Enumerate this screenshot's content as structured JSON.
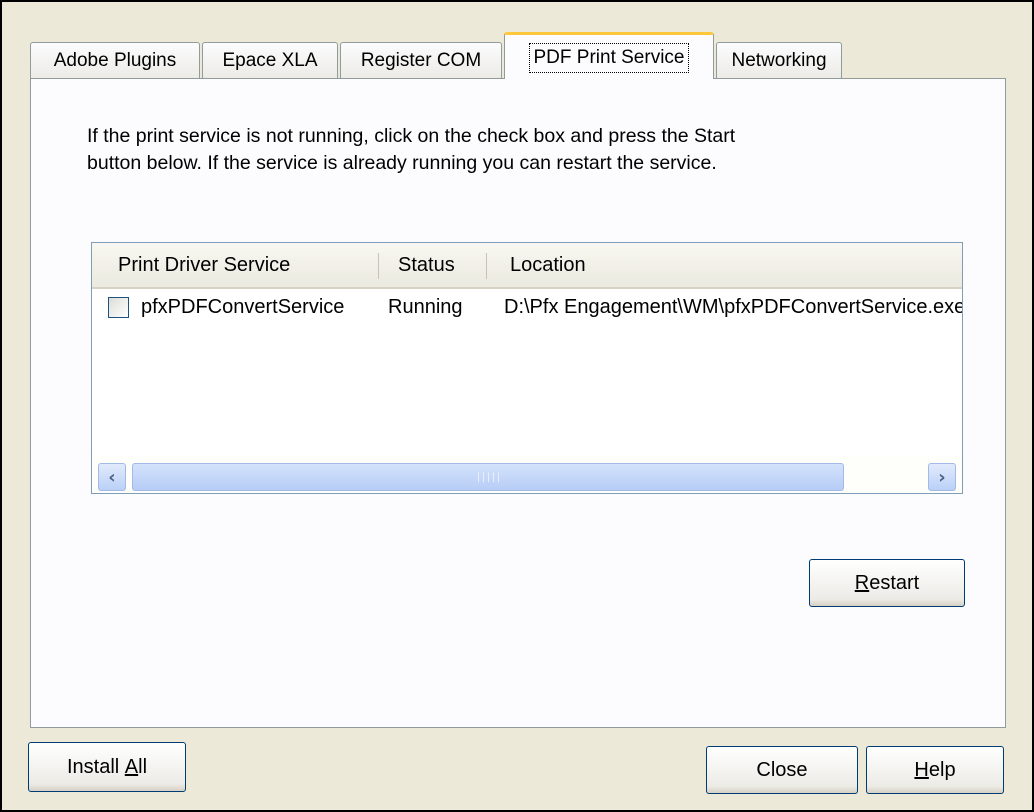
{
  "tabs": [
    {
      "label": "Adobe Plugins",
      "active": false
    },
    {
      "label": "Epace XLA",
      "active": false
    },
    {
      "label": "Register COM",
      "active": false
    },
    {
      "label": "PDF Print Service",
      "active": true
    },
    {
      "label": "Networking",
      "active": false
    }
  ],
  "instructions": {
    "line1": "If the print service is not running, click on the check box and press the Start",
    "line2": "button below.  If the service is already running you can restart the service."
  },
  "list": {
    "columns": [
      "Print Driver Service",
      "Status",
      "Location"
    ],
    "rows": [
      {
        "checked": false,
        "service": "pfxPDFConvertService",
        "status": "Running",
        "location": "D:\\Pfx Engagement\\WM\\pfxPDFConvertService.exe"
      }
    ],
    "scrollbar": {
      "left_icon": "scroll-left-arrow-icon",
      "right_icon": "scroll-right-arrow-icon",
      "grip": "|||||"
    }
  },
  "buttons": {
    "restart": {
      "prefix": "",
      "mnemonic": "R",
      "suffix": "estart"
    },
    "install_all": {
      "prefix": "Install ",
      "mnemonic": "A",
      "suffix": "ll"
    },
    "close": {
      "label": "Close"
    },
    "help": {
      "prefix": "",
      "mnemonic": "H",
      "suffix": "elp"
    }
  },
  "colors": {
    "dialog_bg": "#ece9d8",
    "active_tab_accent": "#ffc83c",
    "button_border": "#003c74",
    "scrollbar": "#b9d0f7"
  }
}
